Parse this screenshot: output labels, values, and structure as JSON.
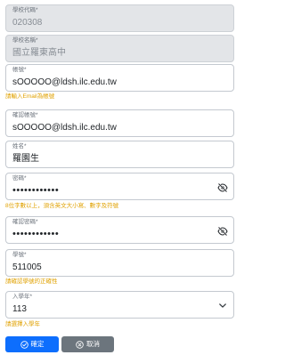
{
  "form": {
    "school_code": {
      "label": "學校代碼*",
      "value": "020308"
    },
    "school_name": {
      "label": "學校名稱*",
      "value": "國立羅東高中"
    },
    "account": {
      "label": "帳號*",
      "value": "sOOOOO@ldsh.ilc.edu.tw",
      "hint": "請輸入Email為帳號"
    },
    "confirm_account": {
      "label": "確認帳號*",
      "value": "sOOOOO@ldsh.ilc.edu.tw"
    },
    "name": {
      "label": "姓名*",
      "value": "羅園生"
    },
    "password": {
      "label": "密碼*",
      "value": "••••••••••••",
      "hint": "8位字數以上，須含英文大小寫、數字及符號"
    },
    "confirm_password": {
      "label": "確認密碼*",
      "value": "••••••••••••"
    },
    "student_id": {
      "label": "學號*",
      "value": "511005",
      "hint": "請確認學號的正確性"
    },
    "enrollment_year": {
      "label": "入學年*",
      "value": "113",
      "hint": "請選擇入學年"
    }
  },
  "buttons": {
    "confirm_label": "確定",
    "cancel_label": "取消"
  },
  "colors": {
    "primary": "#0d6efd",
    "secondary": "#6c757d",
    "hint": "#e0a100",
    "disabled_bg": "#e3e5e8"
  },
  "icons": {
    "password_toggle": "eye-slash-icon",
    "select_arrow": "chevron-down-icon",
    "confirm": "check-circle-icon",
    "cancel": "x-circle-icon"
  }
}
